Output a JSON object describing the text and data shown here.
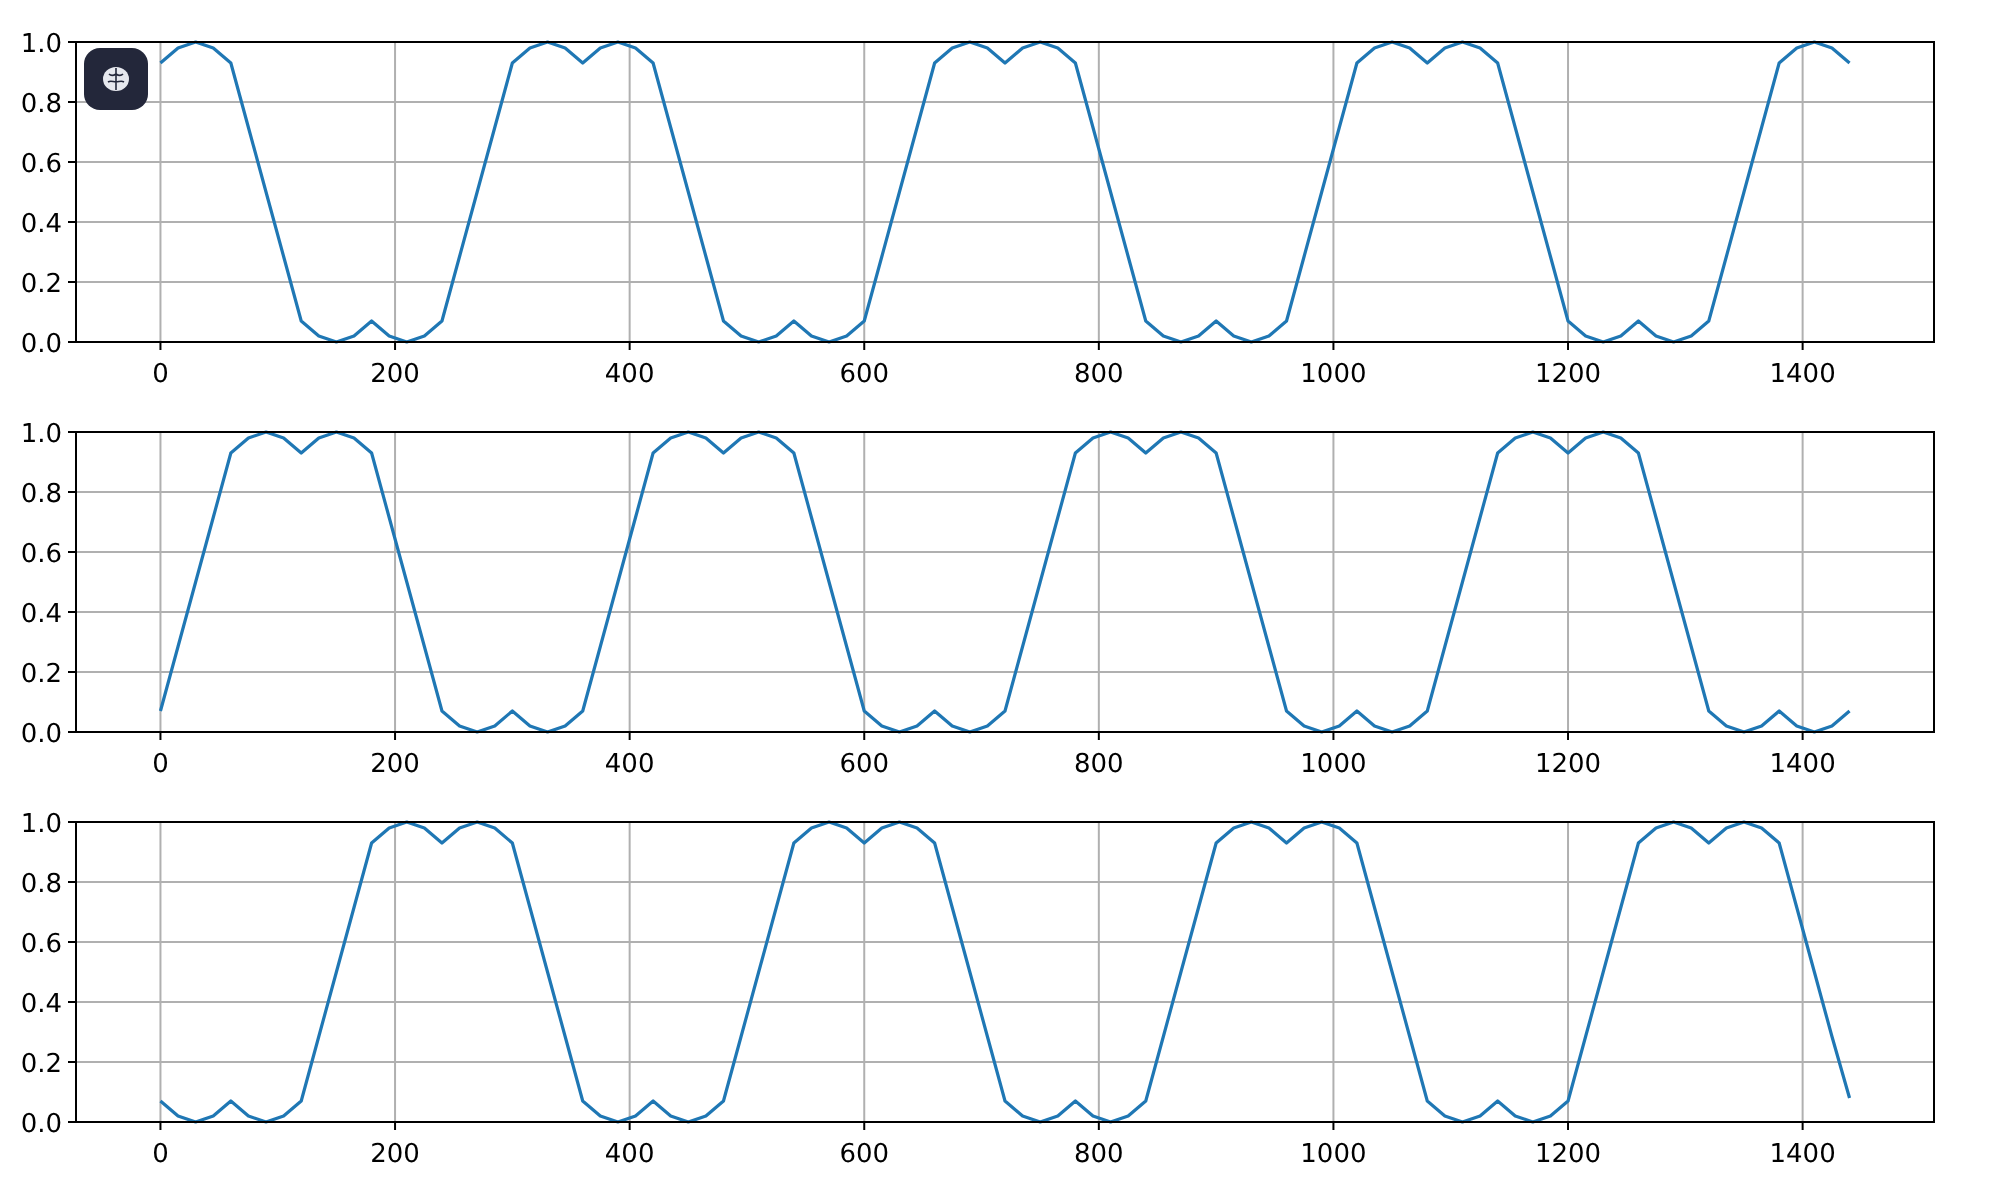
{
  "figure": {
    "charts": [
      {
        "chart_data": {
          "type": "line",
          "xlim": [
            -72,
            1512
          ],
          "ylim": [
            0,
            1
          ],
          "xticks": [
            0,
            200,
            400,
            600,
            800,
            1000,
            1200,
            1400
          ],
          "yticks": [
            {
              "value": 0,
              "label": "0.0"
            },
            {
              "value": 0.2,
              "label": "0.2"
            },
            {
              "value": 0.4,
              "label": "0.4"
            },
            {
              "value": 0.6,
              "label": "0.6"
            },
            {
              "value": 0.8,
              "label": "0.8"
            },
            {
              "value": 1,
              "label": "1.0"
            }
          ],
          "grid": true,
          "x": [
            0,
            15,
            30,
            45,
            60,
            75,
            90,
            105,
            120,
            135,
            150,
            165,
            180,
            195,
            210,
            225,
            240,
            255,
            270,
            285,
            300,
            315,
            330,
            345,
            360,
            375,
            390,
            405,
            420,
            435,
            450,
            465,
            480,
            495,
            510,
            525,
            540,
            555,
            570,
            585,
            600,
            615,
            630,
            645,
            660,
            675,
            690,
            705,
            720,
            735,
            750,
            765,
            780,
            795,
            810,
            825,
            840,
            855,
            870,
            885,
            900,
            915,
            930,
            945,
            960,
            975,
            990,
            1005,
            1020,
            1035,
            1050,
            1065,
            1080,
            1095,
            1110,
            1125,
            1140,
            1155,
            1170,
            1185,
            1200,
            1215,
            1230,
            1245,
            1260,
            1275,
            1290,
            1305,
            1320,
            1335,
            1350,
            1365,
            1380,
            1395,
            1410,
            1425,
            1440
          ],
          "series": [
            {
              "color": "#1f77b4",
              "values": [
                0.93,
                0.98,
                1,
                0.98,
                0.93,
                0.715,
                0.5,
                0.285,
                0.07,
                0.02,
                0,
                0.02,
                0.07,
                0.02,
                0,
                0.02,
                0.07,
                0.285,
                0.5,
                0.715,
                0.93,
                0.98,
                1,
                0.98,
                0.93,
                0.98,
                1,
                0.98,
                0.93,
                0.715,
                0.5,
                0.285,
                0.07,
                0.02,
                0,
                0.02,
                0.07,
                0.02,
                0,
                0.02,
                0.07,
                0.285,
                0.5,
                0.715,
                0.93,
                0.98,
                1,
                0.98,
                0.93,
                0.98,
                1,
                0.98,
                0.93,
                0.715,
                0.5,
                0.285,
                0.07,
                0.02,
                0,
                0.02,
                0.07,
                0.02,
                0,
                0.02,
                0.07,
                0.285,
                0.5,
                0.715,
                0.93,
                0.98,
                1,
                0.98,
                0.93,
                0.98,
                1,
                0.98,
                0.93,
                0.715,
                0.5,
                0.285,
                0.07,
                0.02,
                0,
                0.02,
                0.07,
                0.02,
                0,
                0.02,
                0.07,
                0.285,
                0.5,
                0.715,
                0.93,
                0.98,
                1,
                0.98,
                0.93
              ]
            }
          ]
        }
      },
      {
        "chart_data": {
          "type": "line",
          "xlim": [
            -72,
            1512
          ],
          "ylim": [
            0,
            1
          ],
          "xticks": [
            0,
            200,
            400,
            600,
            800,
            1000,
            1200,
            1400
          ],
          "yticks": [
            {
              "value": 0,
              "label": "0.0"
            },
            {
              "value": 0.2,
              "label": "0.2"
            },
            {
              "value": 0.4,
              "label": "0.4"
            },
            {
              "value": 0.6,
              "label": "0.6"
            },
            {
              "value": 0.8,
              "label": "0.8"
            },
            {
              "value": 1,
              "label": "1.0"
            }
          ],
          "x": [
            0,
            15,
            30,
            45,
            60,
            75,
            90,
            105,
            120,
            135,
            150,
            165,
            180,
            195,
            210,
            225,
            240,
            255,
            270,
            285,
            300,
            315,
            330,
            345,
            360,
            375,
            390,
            405,
            420,
            435,
            450,
            465,
            480,
            495,
            510,
            525,
            540,
            555,
            570,
            585,
            600,
            615,
            630,
            645,
            660,
            675,
            690,
            705,
            720,
            735,
            750,
            765,
            780,
            795,
            810,
            825,
            840,
            855,
            870,
            885,
            900,
            915,
            930,
            945,
            960,
            975,
            990,
            1005,
            1020,
            1035,
            1050,
            1065,
            1080,
            1095,
            1110,
            1125,
            1140,
            1155,
            1170,
            1185,
            1200,
            1215,
            1230,
            1245,
            1260,
            1275,
            1290,
            1305,
            1320,
            1335,
            1350,
            1365,
            1380,
            1395,
            1410,
            1425,
            1440
          ],
          "grid": true,
          "series": [
            {
              "color": "#1f77b4",
              "values": [
                0.07,
                0.285,
                0.5,
                0.715,
                0.93,
                0.98,
                1,
                0.98,
                0.93,
                0.98,
                1,
                0.98,
                0.93,
                0.715,
                0.5,
                0.285,
                0.07,
                0.02,
                0,
                0.02,
                0.07,
                0.02,
                0,
                0.02,
                0.07,
                0.285,
                0.5,
                0.715,
                0.93,
                0.98,
                1,
                0.98,
                0.93,
                0.98,
                1,
                0.98,
                0.93,
                0.715,
                0.5,
                0.285,
                0.07,
                0.02,
                0,
                0.02,
                0.07,
                0.02,
                0,
                0.02,
                0.07,
                0.285,
                0.5,
                0.715,
                0.93,
                0.98,
                1,
                0.98,
                0.93,
                0.98,
                1,
                0.98,
                0.93,
                0.715,
                0.5,
                0.285,
                0.07,
                0.02,
                0,
                0.02,
                0.07,
                0.02,
                0,
                0.02,
                0.07,
                0.285,
                0.5,
                0.715,
                0.93,
                0.98,
                1,
                0.98,
                0.93,
                0.98,
                1,
                0.98,
                0.93,
                0.715,
                0.5,
                0.285,
                0.07,
                0.02,
                0,
                0.02,
                0.07,
                0.02,
                0,
                0.02,
                0.07
              ]
            }
          ]
        }
      },
      {
        "chart_data": {
          "type": "line",
          "xlim": [
            -72,
            1512
          ],
          "ylim": [
            0,
            1
          ],
          "xticks": [
            0,
            200,
            400,
            600,
            800,
            1000,
            1200,
            1400
          ],
          "yticks": [
            {
              "value": 0,
              "label": "0.0"
            },
            {
              "value": 0.2,
              "label": "0.2"
            },
            {
              "value": 0.4,
              "label": "0.4"
            },
            {
              "value": 0.6,
              "label": "0.6"
            },
            {
              "value": 0.8,
              "label": "0.8"
            },
            {
              "value": 1,
              "label": "1.0"
            }
          ],
          "x": [
            0,
            15,
            30,
            45,
            60,
            75,
            90,
            105,
            120,
            135,
            150,
            165,
            180,
            195,
            210,
            225,
            240,
            255,
            270,
            285,
            300,
            315,
            330,
            345,
            360,
            375,
            390,
            405,
            420,
            435,
            450,
            465,
            480,
            495,
            510,
            525,
            540,
            555,
            570,
            585,
            600,
            615,
            630,
            645,
            660,
            675,
            690,
            705,
            720,
            735,
            750,
            765,
            780,
            795,
            810,
            825,
            840,
            855,
            870,
            885,
            900,
            915,
            930,
            945,
            960,
            975,
            990,
            1005,
            1020,
            1035,
            1050,
            1065,
            1080,
            1095,
            1110,
            1125,
            1140,
            1155,
            1170,
            1185,
            1200,
            1215,
            1230,
            1245,
            1260,
            1275,
            1290,
            1305,
            1320,
            1335,
            1350,
            1365,
            1380,
            1395,
            1410,
            1425,
            1440
          ],
          "grid": true,
          "series": [
            {
              "color": "#1f77b4",
              "values": [
                0.07,
                0.02,
                0,
                0.02,
                0.07,
                0.02,
                0,
                0.02,
                0.07,
                0.285,
                0.5,
                0.715,
                0.93,
                0.98,
                1,
                0.98,
                0.93,
                0.98,
                1,
                0.98,
                0.93,
                0.715,
                0.5,
                0.285,
                0.07,
                0.02,
                0,
                0.02,
                0.07,
                0.02,
                0,
                0.02,
                0.07,
                0.285,
                0.5,
                0.715,
                0.93,
                0.98,
                1,
                0.98,
                0.93,
                0.98,
                1,
                0.98,
                0.93,
                0.715,
                0.5,
                0.285,
                0.07,
                0.02,
                0,
                0.02,
                0.07,
                0.02,
                0,
                0.02,
                0.07,
                0.285,
                0.5,
                0.715,
                0.93,
                0.98,
                1,
                0.98,
                0.93,
                0.98,
                1,
                0.98,
                0.93,
                0.715,
                0.5,
                0.285,
                0.07,
                0.02,
                0,
                0.02,
                0.07,
                0.02,
                0,
                0.02,
                0.07,
                0.285,
                0.5,
                0.715,
                0.93,
                0.98,
                1,
                0.98,
                0.93,
                0.98,
                1,
                0.98,
                0.93,
                0.715,
                0.5,
                0.285,
                0.08
              ]
            }
          ]
        }
      }
    ]
  }
}
